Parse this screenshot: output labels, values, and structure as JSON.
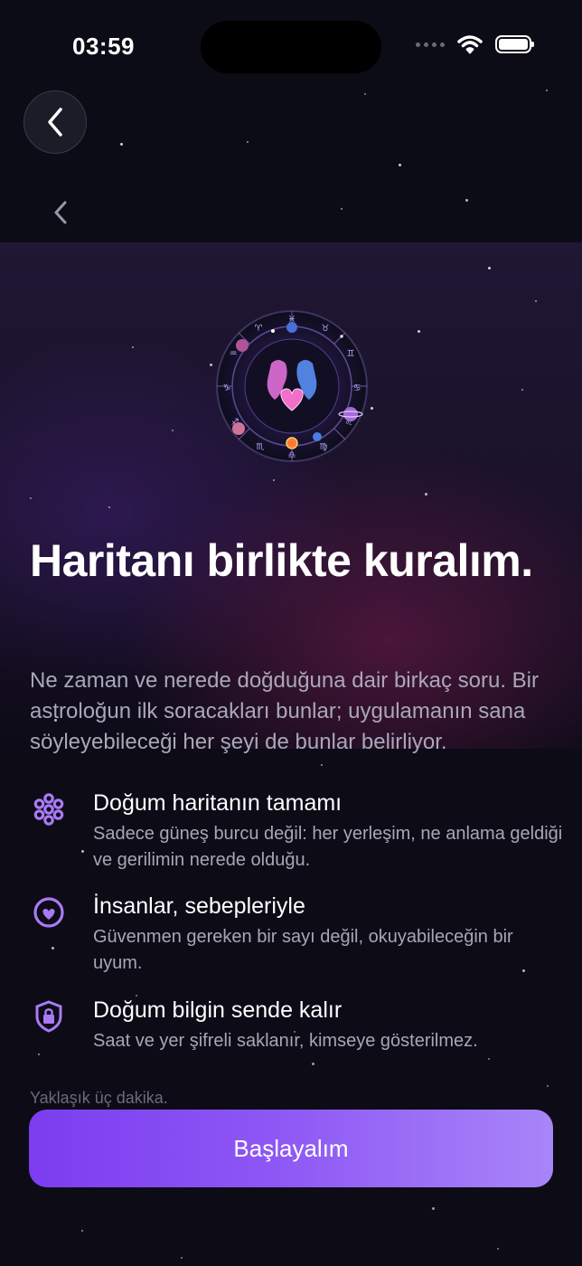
{
  "status_bar": {
    "time": "03:59"
  },
  "hero": {
    "title": "Haritanı birlikte kuralım.",
    "subtitle": "Ne zaman ve nerede doğduğuna dair birkaç soru. Bir astroloğun ilk soracakları bunlar; uygulamanın sana söyleyebileceği her şeyi de bunlar belirliyor."
  },
  "features": [
    {
      "icon": "flower-pattern-icon",
      "title": "Doğum haritanın tamamı",
      "desc": "Sadece güneş burcu değil: her yerleşim, ne anlama geldiği ve gerilimin nerede olduğu."
    },
    {
      "icon": "heart-circle-icon",
      "title": "İnsanlar, sebepleriyle",
      "desc": "Güvenmen gereken bir sayı değil, okuyabileceğin bir uyum."
    },
    {
      "icon": "lock-shield-icon",
      "title": "Doğum bilgin sende kalır",
      "desc": "Saat ve yer şifreli saklanır, kimseye gösterilmez."
    }
  ],
  "footer": {
    "note": "Yaklaşık üç dakika.",
    "cta_label": "Başlayalım"
  },
  "colors": {
    "accent": "#8b50f4",
    "background": "#0c0b16",
    "icon": "#a979f5"
  }
}
